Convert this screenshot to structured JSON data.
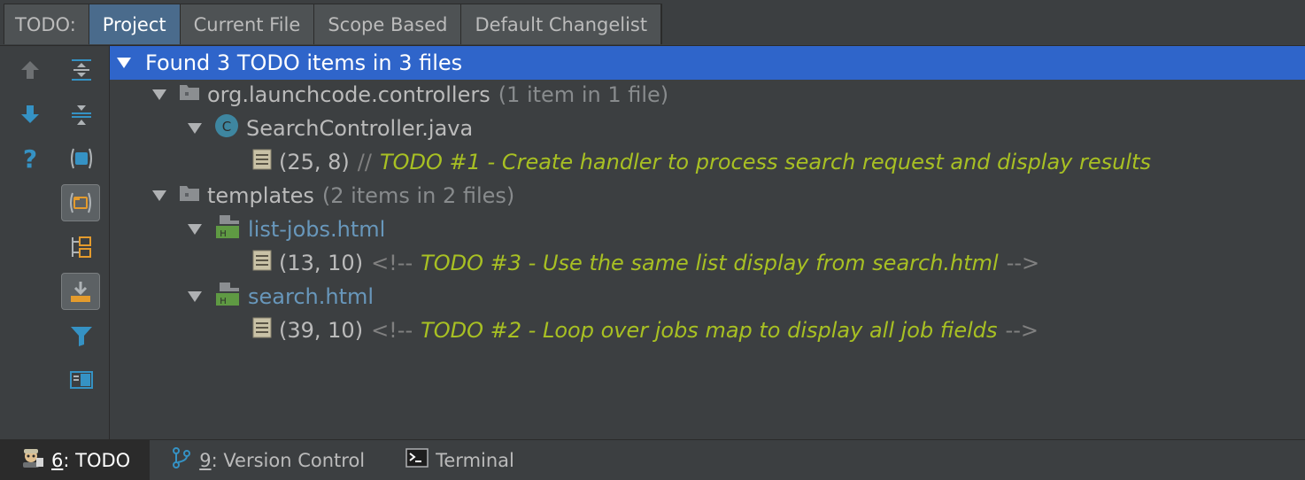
{
  "tabs": {
    "prefix": "TODO:",
    "items": [
      {
        "label": "Project",
        "active": true
      },
      {
        "label": "Current File",
        "active": false
      },
      {
        "label": "Scope Based",
        "active": false
      },
      {
        "label": "Default Changelist",
        "active": false
      }
    ]
  },
  "toolbar": {
    "left": [
      "up-arrow-icon",
      "down-arrow-icon",
      "help-icon"
    ],
    "right": [
      "expand-all-icon",
      "collapse-all-icon",
      "module-icon",
      "group-by-package-icon",
      "flatten-icon",
      "autoscroll-icon",
      "filter-icon",
      "preview-icon"
    ]
  },
  "tree": {
    "root": "Found 3 TODO items in 3 files",
    "packages": [
      {
        "name": "org.launchcode.controllers",
        "count": "(1 item in 1 file)",
        "files": [
          {
            "name": "SearchController.java",
            "type": "java",
            "items": [
              {
                "loc": "(25, 8)",
                "prefix": "//",
                "text": "TODO #1 - Create handler to process search request and display results",
                "suffix": ""
              }
            ]
          }
        ]
      },
      {
        "name": "templates",
        "count": "(2 items in 2 files)",
        "files": [
          {
            "name": "list-jobs.html",
            "type": "html",
            "items": [
              {
                "loc": "(13, 10)",
                "prefix": "<!--",
                "text": "TODO #3 - Use the same list display from search.html",
                "suffix": "-->"
              }
            ]
          },
          {
            "name": "search.html",
            "type": "html",
            "items": [
              {
                "loc": "(39, 10)",
                "prefix": "<!--",
                "text": "TODO #2 - Loop over jobs map to display all job fields",
                "suffix": "-->"
              }
            ]
          }
        ]
      }
    ]
  },
  "bottom": {
    "todo": {
      "num": "6",
      "label": ": TODO"
    },
    "vcs": {
      "num": "9",
      "label": ": Version Control"
    },
    "terminal": {
      "label": "Terminal"
    }
  },
  "colors": {
    "selection": "#2f65ca",
    "todo_text": "#a8c023",
    "html_file": "#6897bb",
    "background": "#3c3f41"
  }
}
